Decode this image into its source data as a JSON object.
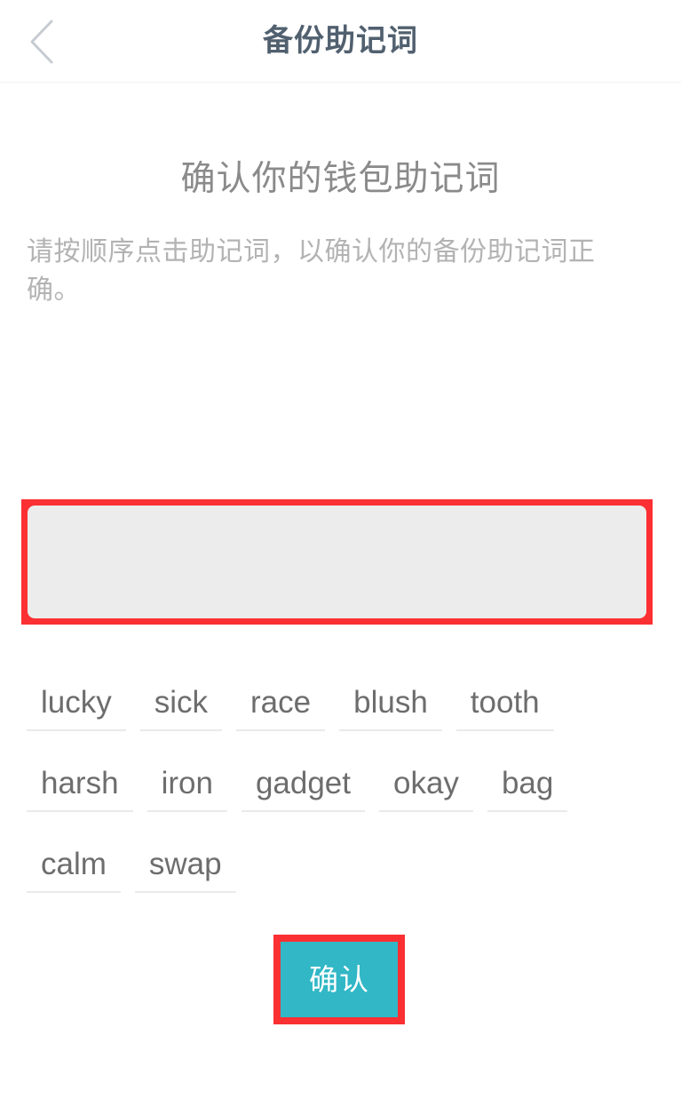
{
  "header": {
    "title": "备份助记词",
    "back_icon": "chevron-left-icon"
  },
  "main": {
    "heading": "确认你的钱包助记词",
    "description": "请按顺序点击助记词，以确认你的备份助记词正确。",
    "selected_words": [],
    "selected_area_placeholder": ""
  },
  "word_bank": {
    "words": [
      "lucky",
      "sick",
      "race",
      "blush",
      "tooth",
      "harsh",
      "iron",
      "gadget",
      "okay",
      "bag",
      "calm",
      "swap"
    ]
  },
  "footer": {
    "confirm_label": "确认"
  },
  "colors": {
    "header_title": "#51606f",
    "heading": "#8a8a8a",
    "description": "#b3b3b3",
    "word_text": "#6d6d6d",
    "word_underline": "#eaeaea",
    "drop_area_bg": "#ececec",
    "annotation_red": "#fb3033",
    "confirm_teal": "#31b7c6",
    "page_bg": "#ffffff"
  }
}
